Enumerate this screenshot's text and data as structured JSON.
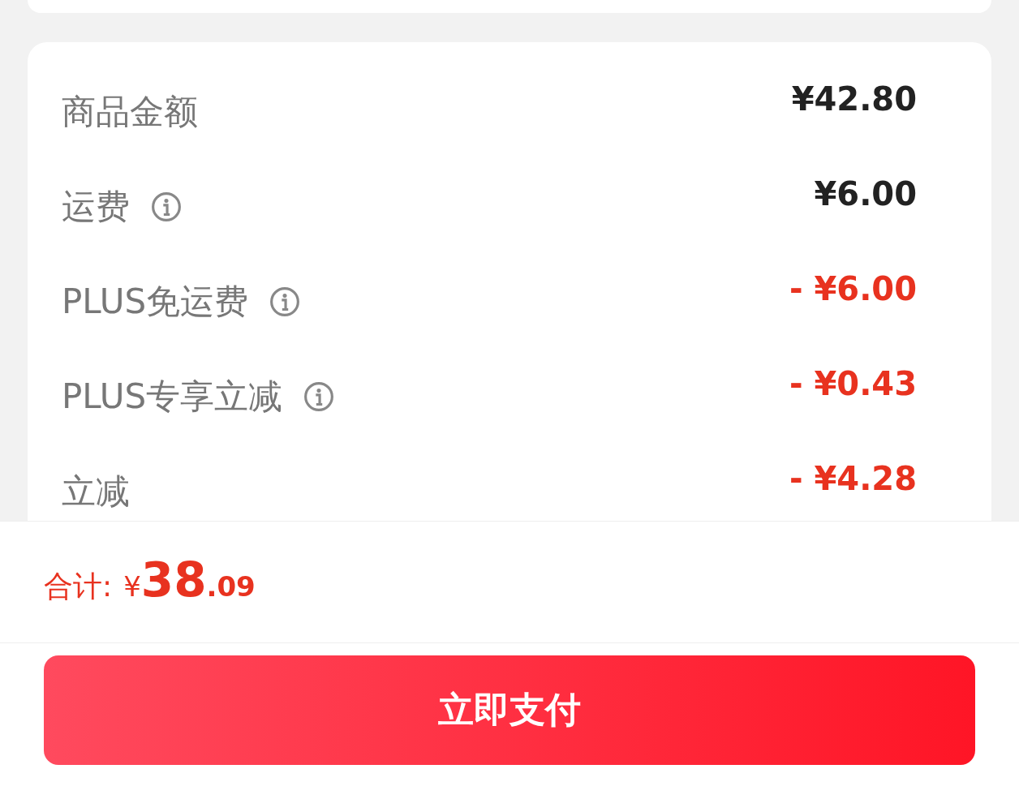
{
  "fees": [
    {
      "label": "商品金额",
      "info": false,
      "kind": "charge",
      "value": "¥42.80"
    },
    {
      "label": "运费",
      "info": true,
      "kind": "charge",
      "value": "¥6.00"
    },
    {
      "label": "PLUS免运费",
      "info": true,
      "kind": "discount",
      "value": "- ¥6.00"
    },
    {
      "label": "PLUS专享立减",
      "info": true,
      "kind": "discount",
      "value": "- ¥0.43"
    },
    {
      "label": "立减",
      "info": false,
      "kind": "discount",
      "value": "- ¥4.28"
    }
  ],
  "total": {
    "label": "合计:",
    "currency": "¥",
    "integer": "38",
    "decimal": ".09"
  },
  "pay_button": "立即支付"
}
